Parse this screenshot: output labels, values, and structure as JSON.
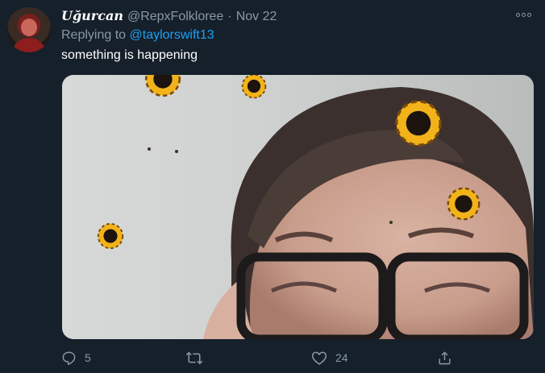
{
  "tweet": {
    "display_name": "Uğurcan",
    "handle": "@RepxFolkloree",
    "separator": "·",
    "date": "Nov 22",
    "replying_prefix": "Replying to",
    "replying_to": "@taylorswift13",
    "text": "something is happening"
  },
  "actions": {
    "reply_count": "5",
    "retweet_count": "",
    "like_count": "24"
  },
  "icons": {
    "more": "more-icon",
    "reply": "reply-icon",
    "retweet": "retweet-icon",
    "like": "heart-icon",
    "share": "share-icon"
  },
  "colors": {
    "background": "#15202b",
    "secondary_text": "#8899a6",
    "link": "#1da1f2",
    "primary_text": "#ffffff"
  }
}
